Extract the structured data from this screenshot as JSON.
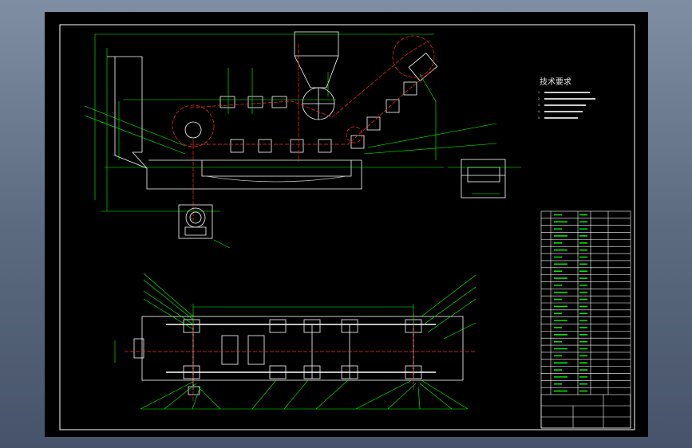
{
  "drawing": {
    "tech_requirements": {
      "title": "技术要求",
      "items": [
        "1.",
        "2.",
        "3.",
        "4.",
        "5."
      ]
    },
    "colors": {
      "background": "#000000",
      "outline": "#ffffff",
      "dimension": "#00ff00",
      "centerline": "#ff2a2a",
      "frame": "#ffffff"
    }
  }
}
